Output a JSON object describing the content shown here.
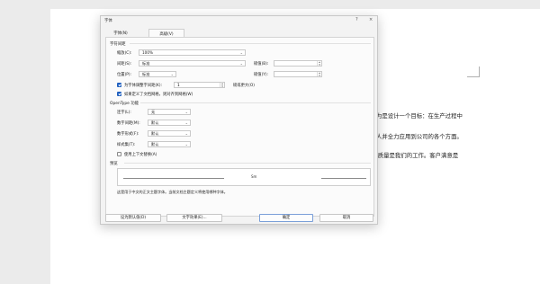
{
  "document": {
    "lines": [
      "为是设计一个目标：在生产过程中",
      "人并全力应用到公司的各个方面。",
      "'质量是我们的工作。客户满意是"
    ]
  },
  "dialog": {
    "title": "字体",
    "help_label": "?",
    "close_label": "×",
    "tabs": [
      {
        "label": "字体(N)",
        "active": false
      },
      {
        "label": "高级(V)",
        "active": true
      }
    ],
    "spacing": {
      "heading": "字符间距",
      "scale_label": "缩放(C):",
      "scale_value": "100%",
      "spacing_label": "间距(S):",
      "spacing_value": "标准",
      "spacing_by_label": "磅值(B):",
      "spacing_by_value": "",
      "position_label": "位置(P):",
      "position_value": "标准",
      "position_by_label": "磅值(Y):",
      "position_by_value": "",
      "kerning_label": "为字体调整字间距(K):",
      "kerning_checked": true,
      "kerning_value": "1",
      "kerning_suffix": "磅或更大(O)",
      "grid_label": "如果定义了文档网格，则对齐到网格(W)",
      "grid_checked": true
    },
    "opentype": {
      "heading": "OpenType 功能",
      "ligatures_label": "连字(L):",
      "ligatures_value": "无",
      "numspacing_label": "数字间距(M):",
      "numspacing_value": "默认",
      "numforms_label": "数字形式(F):",
      "numforms_value": "默认",
      "stylesets_label": "样式集(T):",
      "stylesets_value": "默认",
      "contextual_label": "使用上下文替换(A)",
      "contextual_checked": false
    },
    "preview": {
      "heading": "预览",
      "sample": "Sm",
      "note": "这是用于中文的正文主题字体。当前文档主题定义将使用哪种字体。"
    },
    "buttons": {
      "default_label": "设为默认值(D)",
      "effects_label": "文字效果(E)...",
      "ok_label": "确定",
      "cancel_label": "取消"
    },
    "colors": {
      "accent": "#1f5fbf",
      "panel": "#fbfbfb",
      "frame": "#f3f3f3"
    }
  }
}
